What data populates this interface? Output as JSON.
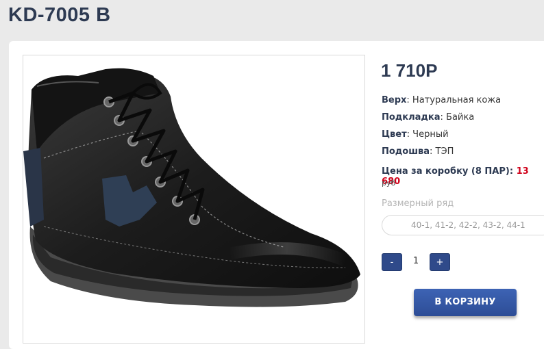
{
  "product": {
    "title": "KD-7005 B",
    "price": "1 710Р",
    "image_alt": "black-boot-photo"
  },
  "specs": [
    {
      "label": "Верх",
      "value": ": Натуральная кожа"
    },
    {
      "label": "Подкладка",
      "value": ": Байка"
    },
    {
      "label": "Цвет",
      "value": ": Черный"
    },
    {
      "label": "Подошва",
      "value": ": ТЭП"
    }
  ],
  "box_price": {
    "label": "Цена за коробку (8 ПАР): ",
    "value": "13 680",
    "currency": "руб"
  },
  "sizes": {
    "label": "Размерный ряд",
    "value": "40-1, 41-2, 42-2, 43-2, 44-1"
  },
  "quantity": {
    "minus": "-",
    "value": "1",
    "plus": "+"
  },
  "cart_button": "В КОРЗИНУ",
  "colors": {
    "accent": "#2f4a8a",
    "price_red": "#d0021b",
    "title": "#2d3a52"
  }
}
